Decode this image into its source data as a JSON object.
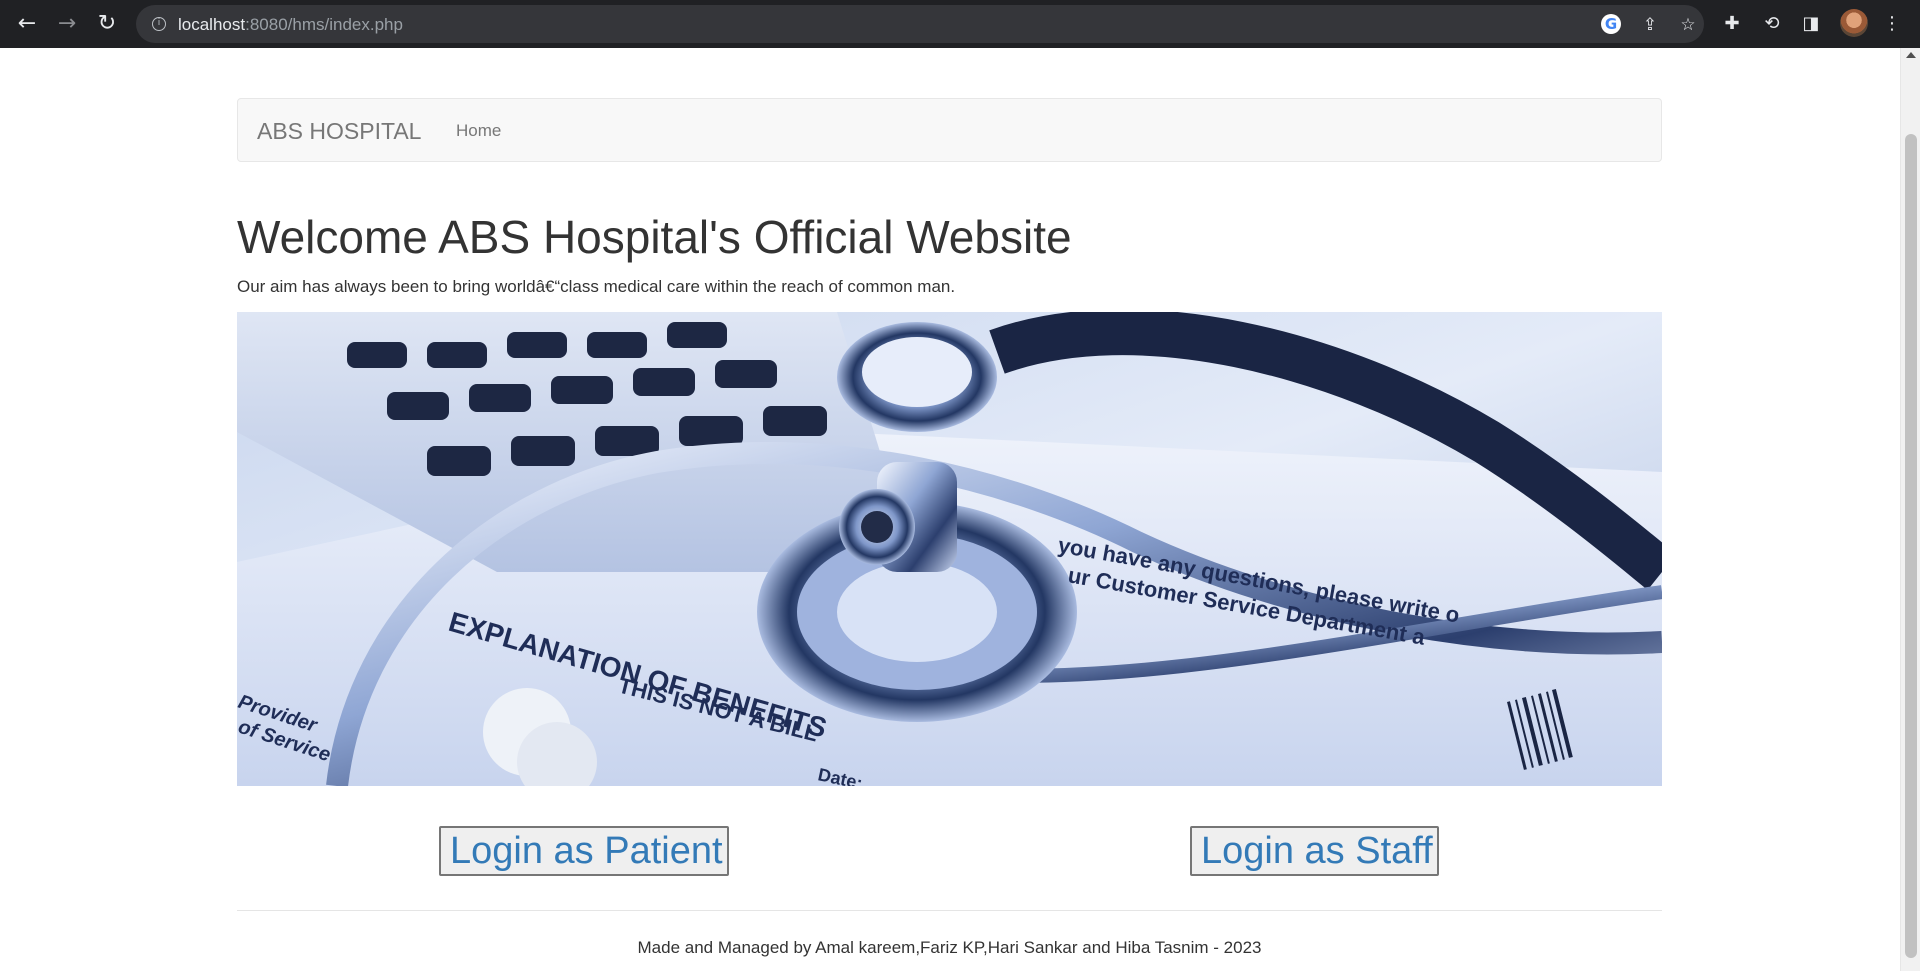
{
  "browser": {
    "url_host": "localhost",
    "url_path": ":8080/hms/index.php",
    "icons": [
      "back-icon",
      "forward-icon",
      "reload-icon",
      "info-icon",
      "google-icon",
      "share-icon",
      "bookmark-star-icon",
      "extensions-icon",
      "sync-icon",
      "side-panel-icon",
      "profile-avatar",
      "menu-icon"
    ]
  },
  "navbar": {
    "brand": "ABS HOSPITAL",
    "home": "Home"
  },
  "main": {
    "heading": "Welcome ABS Hospital's Official Website",
    "tagline": "Our aim has always been to bring worldâ€“class medical care within the reach of common man."
  },
  "hero": {
    "subject": "stethoscope-calculator-form",
    "text_line1": "EXPLANATION OF BENEFITS",
    "text_line2": "THIS IS NOT A BILL",
    "text_line3": "Date:",
    "text_line4": "you have any questions, please write o",
    "text_line5": "ur Customer Service Department a",
    "text_line6": "Provider",
    "text_line7": "of Service"
  },
  "actions": {
    "patient_login": "Login as Patient",
    "staff_login": "Login as Staff"
  },
  "footer": {
    "credits": "Made and Managed by Amal kareem,Fariz KP,Hari Sankar and Hiba Tasnim - 2023"
  },
  "colors": {
    "link": "#337ab7",
    "navbar_bg": "#f8f8f8",
    "chrome_bg": "#202124"
  }
}
